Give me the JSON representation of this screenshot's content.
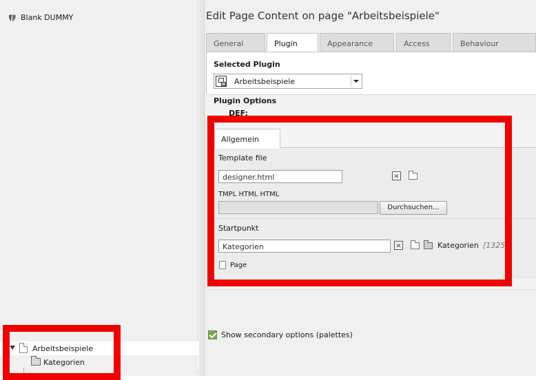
{
  "tree": {
    "root_label": "Blank DUMMY",
    "nodes": [
      {
        "label": "Arbeitsbeispiele",
        "icon": "page-icon"
      },
      {
        "label": "Kategorien",
        "icon": "folder-icon"
      }
    ]
  },
  "main": {
    "title": "Edit Page Content on page \"Arbeitsbeispiele\"",
    "tabs": [
      "General",
      "Plugin",
      "Appearance",
      "Access",
      "Behaviour"
    ],
    "active_tab": "Plugin",
    "selected_plugin_label": "Selected Plugin",
    "selected_plugin_value": "Arbeitsbeispiele",
    "plugin_options_label": "Plugin Options",
    "def_label": "DEF:",
    "flexform": {
      "tab": "Allgemein",
      "template_file_label": "Template file",
      "template_file_value": "designer.html",
      "tmpl_label": "TMPL HTML HTML",
      "browse_label": "Durchsuchen...",
      "startpunkt_label": "Startpunkt",
      "startpunkt_value": "Kategorien",
      "startpunkt_ref_label": "Kategorien",
      "startpunkt_ref_id": "[1325",
      "page_label": "Page"
    },
    "secondary_options_label": "Show secondary options (palettes)"
  },
  "colors": {
    "annotation_red": "#f00000",
    "checkbox_green": "#7aa84a"
  }
}
